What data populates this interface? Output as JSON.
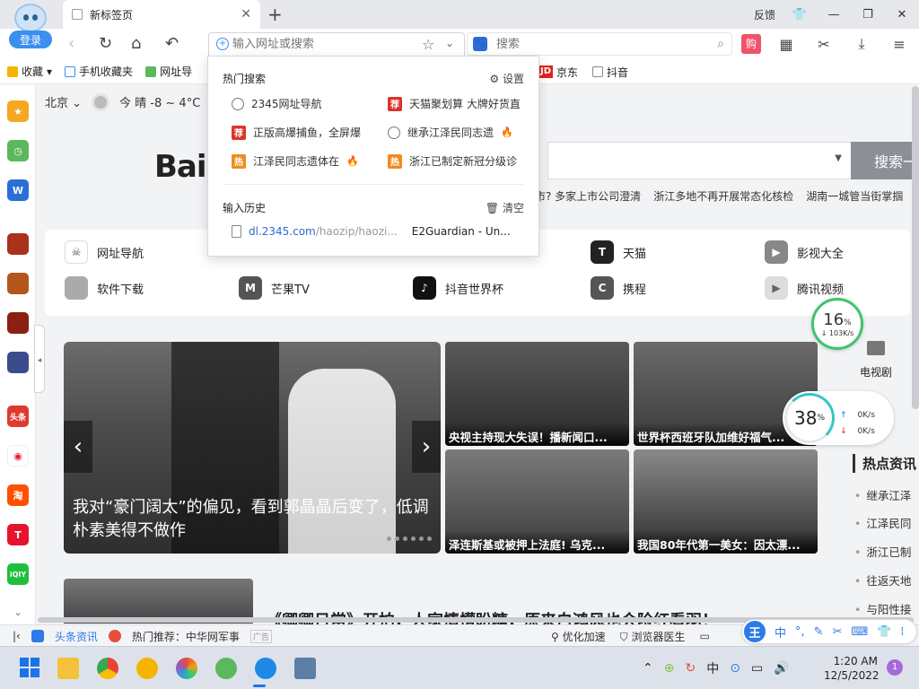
{
  "browser": {
    "login": "登录",
    "tab_title": "新标签页",
    "feedback": "反馈",
    "address_placeholder": "输入网址或搜索",
    "search_placeholder": "搜索",
    "buy_label": "购"
  },
  "bookmarks": {
    "left": [
      "收藏",
      "手机收藏夹",
      "网址导"
    ],
    "right": [
      "京东",
      "抖音"
    ],
    "jd_badge": "JD"
  },
  "dropdown": {
    "hot_title": "热门搜索",
    "settings": "设置",
    "items": [
      {
        "tag": "clock",
        "text": "2345网址导航",
        "fire": false
      },
      {
        "tag": "荐",
        "text": "天猫聚划算 大牌好货直",
        "fire": false
      },
      {
        "tag": "荐",
        "text": "正版高爆捕鱼，全屏爆",
        "fire": false
      },
      {
        "tag": "search",
        "text": "继承江泽民同志遗",
        "fire": true
      },
      {
        "tag": "热",
        "text": "江泽民同志遗体在",
        "fire": true
      },
      {
        "tag": "热",
        "text": "浙江已制定新冠分级诊",
        "fire": false
      }
    ],
    "history_title": "输入历史",
    "clear": "清空",
    "history": [
      {
        "url": "dl.2345.com",
        "path": "/haozip/haozi...",
        "title": "E2Guardian - Un..."
      }
    ]
  },
  "page": {
    "city": "北京",
    "weather": "今 晴 -8 ~ 4°C",
    "logo": "Bai",
    "search_button": "搜索一",
    "ticker": [
      "市? 多家上市公司澄清",
      "浙江多地不再开展常态化核检",
      "湖南一城管当街掌掴"
    ]
  },
  "sites": [
    {
      "name": "网址导航",
      "color": "#ffffff",
      "glyph": "☠"
    },
    {
      "name": "天猫",
      "color": "#222222",
      "glyph": "T"
    },
    {
      "name": "影视大全",
      "color": "#888888",
      "glyph": "▶"
    },
    {
      "name": "软件下载",
      "color": "#aaaaaa",
      "glyph": ""
    },
    {
      "name": "芒果TV",
      "color": "#555555",
      "glyph": "M"
    },
    {
      "name": "抖音世界杯",
      "color": "#111111",
      "glyph": "♪"
    },
    {
      "name": "携程",
      "color": "#555555",
      "glyph": "C"
    },
    {
      "name": "腾讯视频",
      "color": "#dddddd",
      "glyph": "▶"
    }
  ],
  "speed": {
    "small_pct": "16",
    "small_rate": "↓ 103K/s",
    "big_pct": "38",
    "up": "0K/s",
    "down": "0K/s"
  },
  "right_col": {
    "tv": "电视剧",
    "hot_title": "热点资讯",
    "hot_items": [
      "继承江泽",
      "江泽民同",
      "浙江已制",
      "往返天地",
      "与阳性接"
    ]
  },
  "carousel": {
    "caption": "我对“豪门阔太”的偏见，看到郭晶晶后变了，低调朴素美得不做作"
  },
  "thumbs": [
    "央视主持现大失误！播新闻口...",
    "世界杯西班牙队加维好福气...",
    "泽连斯基或被押上法庭! 乌克...",
    "我国80年代第一美女：因太漂..."
  ],
  "story": {
    "title": "《卿卿日常》开拍，人家情懵盼糖，原来白鸿风也会险红看羽！"
  },
  "status": {
    "news": "头条资讯",
    "recommend": "热门推荐：中华网军事",
    "ad": "广告",
    "optimize": "优化加速",
    "doctor": "浏览器医生"
  },
  "ime": {
    "logo": "王",
    "mode": "中"
  },
  "taskbar": {
    "time": "1:20 AM",
    "date": "12/5/2022",
    "ime": "中",
    "notifications": "1"
  },
  "sidebar_badges": {
    "news": "头条",
    "taobao": "淘",
    "tmall": "T",
    "iqiyi": "iQIY"
  }
}
